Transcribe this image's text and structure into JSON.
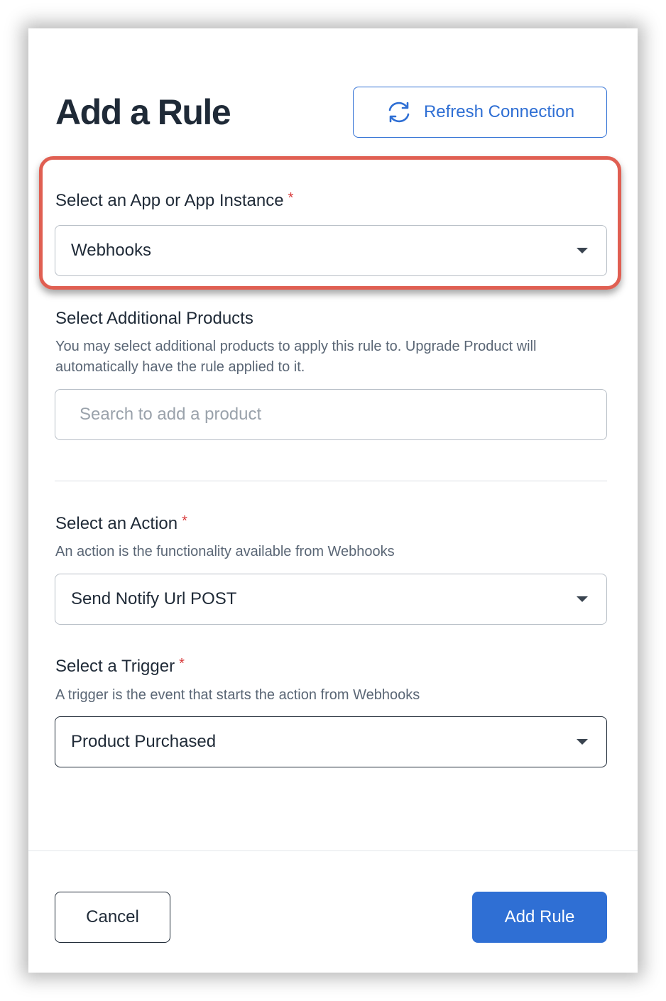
{
  "modal": {
    "title": "Add a Rule",
    "refresh_button": {
      "label": "Refresh Connection",
      "icon": "refresh-icon"
    }
  },
  "app_field": {
    "label": "Select an App or App Instance",
    "required_mark": "*",
    "value": "Webhooks"
  },
  "products_field": {
    "label": "Select Additional Products",
    "help": "You may select additional products to apply this rule to. Upgrade Product will automatically have the rule applied to it.",
    "placeholder": "Search to add a product"
  },
  "action_field": {
    "label": "Select an Action",
    "required_mark": "*",
    "help": "An action is the functionality available from Webhooks",
    "value": "Send Notify Url POST"
  },
  "trigger_field": {
    "label": "Select a Trigger",
    "required_mark": "*",
    "help": "A trigger is the event that starts the action from Webhooks",
    "value": "Product Purchased"
  },
  "footer": {
    "cancel_label": "Cancel",
    "submit_label": "Add Rule"
  },
  "colors": {
    "accent": "#2f6fd4",
    "highlight": "#e05f52",
    "required": "#d8393a",
    "text": "#1f2a37"
  }
}
